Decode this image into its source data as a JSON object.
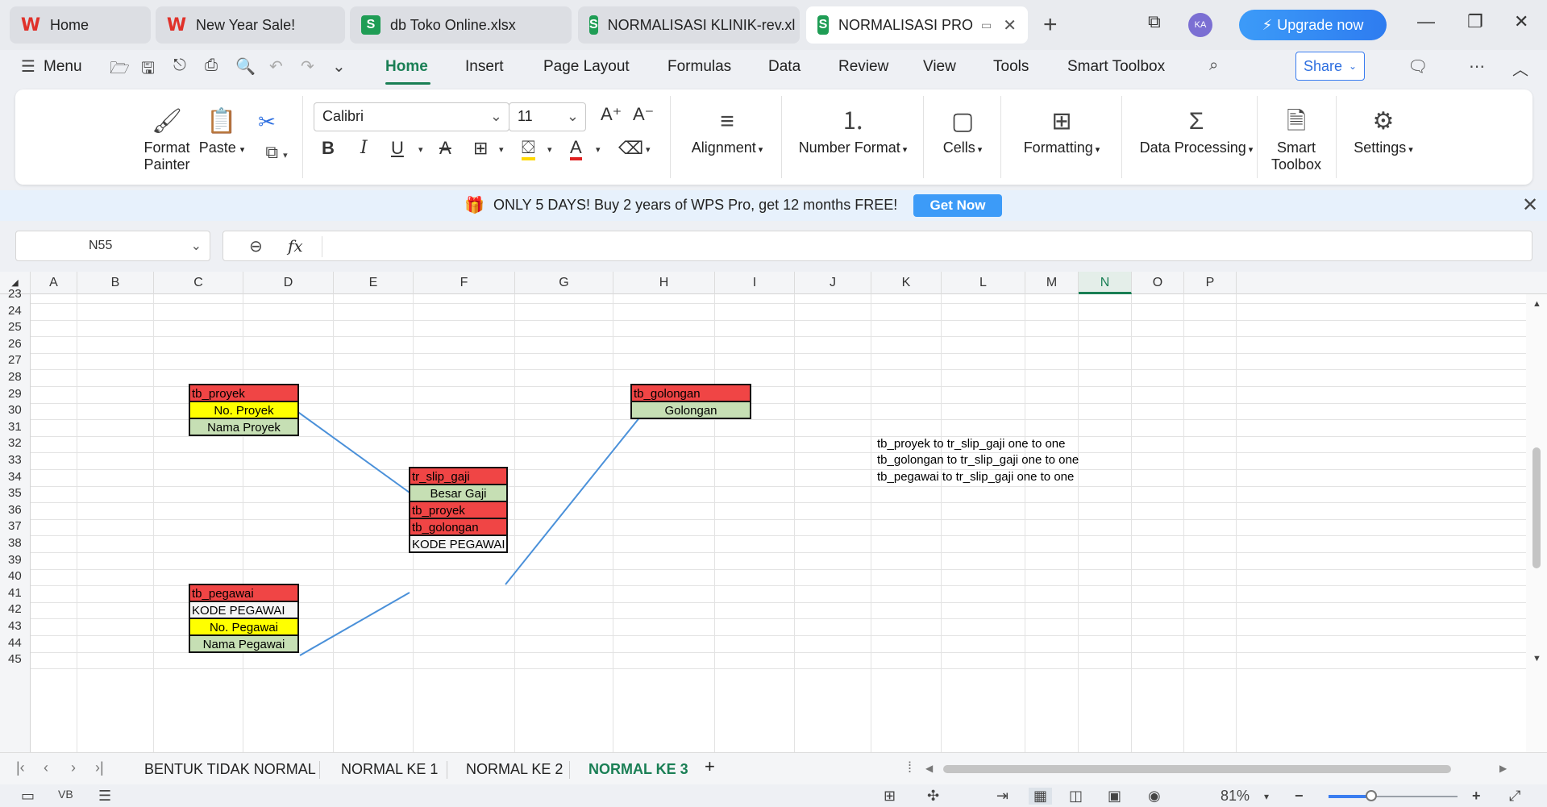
{
  "tabs": [
    {
      "label": "Home",
      "icon": "wps-logo-icon",
      "type": "w"
    },
    {
      "label": "New Year Sale!",
      "icon": "wps-logo-icon",
      "type": "w"
    },
    {
      "label": "db Toko Online.xlsx",
      "icon": "spreadsheet-icon",
      "type": "s"
    },
    {
      "label": "NORMALISASI KLINIK-rev.xl",
      "icon": "spreadsheet-icon",
      "type": "s"
    },
    {
      "label": "NORMALISASI PRO",
      "icon": "spreadsheet-icon",
      "type": "s"
    }
  ],
  "window": {
    "avatar_initials": "KA",
    "upgrade_label": "Upgrade now"
  },
  "menu": {
    "menu_label": "Menu",
    "items": [
      "Home",
      "Insert",
      "Page Layout",
      "Formulas",
      "Data",
      "Review",
      "View",
      "Tools",
      "Smart Toolbox"
    ],
    "active": "Home",
    "share_label": "Share"
  },
  "ribbon": {
    "format_painter": [
      "Format",
      "Painter"
    ],
    "paste": "Paste",
    "font_name": "Calibri",
    "font_size": "11",
    "alignment": "Alignment",
    "number_format": "Number Format",
    "cells": "Cells",
    "formatting": "Formatting",
    "data_processing": "Data Processing",
    "smart_toolbox": [
      "Smart",
      "Toolbox"
    ],
    "settings": "Settings"
  },
  "promo": {
    "text": "ONLY 5 DAYS! Buy 2 years of WPS Pro, get 12 months FREE!",
    "button": "Get Now"
  },
  "formula_bar": {
    "cell_ref": "N55",
    "fx": "fx",
    "value": ""
  },
  "grid": {
    "columns": [
      "A",
      "B",
      "C",
      "D",
      "E",
      "F",
      "G",
      "H",
      "I",
      "J",
      "K",
      "L",
      "M",
      "N",
      "O",
      "P"
    ],
    "selected_column": "N",
    "rows": [
      "23",
      "24",
      "25",
      "26",
      "27",
      "28",
      "29",
      "30",
      "31",
      "32",
      "33",
      "34",
      "35",
      "36",
      "37",
      "38",
      "39",
      "40",
      "41",
      "42",
      "43",
      "44",
      "45"
    ]
  },
  "tables": {
    "tb_proyek": {
      "header": "tb_proyek",
      "rows": [
        "No. Proyek",
        "Nama Proyek"
      ]
    },
    "tb_golongan": {
      "header": "tb_golongan",
      "rows": [
        "Golongan"
      ]
    },
    "tr_slip_gaji": {
      "header": "tr_slip_gaji",
      "rows": [
        "Besar Gaji",
        "tb_proyek",
        "tb_golongan",
        "KODE PEGAWAI"
      ]
    },
    "tb_pegawai": {
      "header": "tb_pegawai",
      "rows": [
        "KODE PEGAWAI",
        "No. Pegawai",
        "Nama Pegawai"
      ]
    }
  },
  "notes": [
    "tb_proyek to tr_slip_gaji one to one",
    "tb_golongan to tr_slip_gaji one to one",
    "tb_pegawai to tr_slip_gaji one to one"
  ],
  "colors": {
    "header_red": "#f04545",
    "key_yellow": "#ffff00",
    "attr_green": "#c6dfb4",
    "link_blue": "#4a90d9",
    "accent": "#1a7f55"
  },
  "sheets": {
    "tabs": [
      "BENTUK TIDAK NORMAL",
      "NORMAL KE 1",
      "NORMAL KE 2",
      "NORMAL KE 3"
    ],
    "active": "NORMAL KE 3"
  },
  "status": {
    "zoom": "81%",
    "zoom_level_fraction": 0.33
  }
}
